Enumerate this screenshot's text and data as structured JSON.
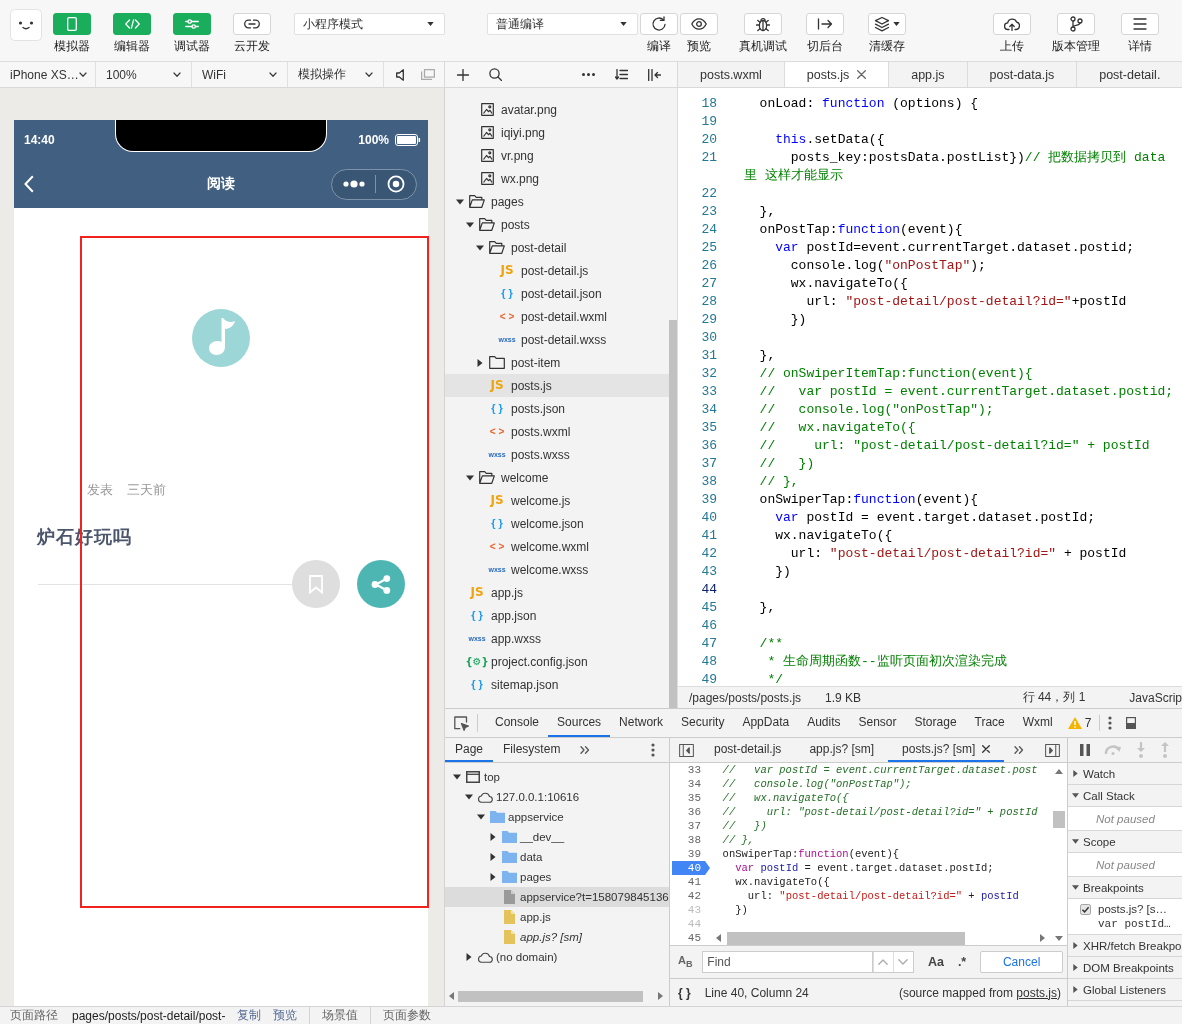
{
  "toolbar": {
    "view_toggles": [
      {
        "kind": "simulator",
        "label": "模拟器",
        "on": true
      },
      {
        "kind": "editor",
        "label": "编辑器",
        "on": true
      },
      {
        "kind": "debugger",
        "label": "调试器",
        "on": true
      },
      {
        "kind": "cloud",
        "label": "云开发",
        "on": false
      }
    ],
    "mode_select": {
      "value": "小程序模式"
    },
    "compile_select": {
      "value": "普通编译"
    },
    "compile_actions": [
      {
        "kind": "compile",
        "label": "编译"
      },
      {
        "kind": "preview",
        "label": "预览"
      }
    ],
    "debug_actions": [
      {
        "kind": "remote-debug",
        "label": "真机调试"
      },
      {
        "kind": "background",
        "label": "切后台"
      },
      {
        "kind": "cache",
        "label": "清缓存"
      }
    ],
    "project_actions": [
      {
        "kind": "upload",
        "label": "上传"
      },
      {
        "kind": "version",
        "label": "版本管理"
      },
      {
        "kind": "details",
        "label": "详情"
      }
    ]
  },
  "simulator_bar": {
    "selects": [
      {
        "value": "iPhone XS…"
      },
      {
        "value": "100%"
      },
      {
        "value": "WiFi"
      },
      {
        "value": "模拟操作"
      }
    ]
  },
  "editor_tabs": [
    {
      "label": "posts.wxml",
      "selected": false
    },
    {
      "label": "posts.js",
      "selected": true
    },
    {
      "label": "app.js",
      "selected": false
    },
    {
      "label": "post-data.js",
      "selected": false
    },
    {
      "label": "post-detail.",
      "selected": false
    }
  ],
  "simulator": {
    "status_bar": {
      "time": "14:40",
      "battery": "100%"
    },
    "nav_bar": {
      "title": "阅读"
    },
    "post": {
      "action": "发表",
      "date": "三天前",
      "title": "炉石好玩吗"
    }
  },
  "file_tree": [
    {
      "kind": "folder",
      "children": [
        {
          "name": "avatar.png",
          "kind": "image",
          "selected": false
        },
        {
          "name": "iqiyi.png",
          "kind": "image",
          "selected": false
        },
        {
          "name": "vr.png",
          "kind": "image",
          "selected": false
        },
        {
          "name": "wx.png",
          "kind": "image",
          "selected": false
        }
      ]
    },
    {
      "name": "pages",
      "kind": "folder",
      "expanded": true,
      "selected": false,
      "children": [
        {
          "name": "posts",
          "kind": "folder",
          "expanded": true,
          "selected": false,
          "children": [
            {
              "name": "post-detail",
              "kind": "folder",
              "expanded": true,
              "selected": false,
              "children": [
                {
                  "name": "post-detail.js",
                  "kind": "js",
                  "type_label": "JS",
                  "selected": false
                },
                {
                  "name": "post-detail.json",
                  "kind": "json",
                  "type_label": "{ }",
                  "selected": false
                },
                {
                  "name": "post-detail.wxml",
                  "kind": "wxml",
                  "type_label": "< >",
                  "selected": false
                },
                {
                  "name": "post-detail.wxss",
                  "kind": "wxss",
                  "type_label": "wxss",
                  "selected": false
                }
              ]
            },
            {
              "name": "post-item",
              "kind": "folder",
              "expanded": false,
              "selected": false
            },
            {
              "name": "posts.js",
              "kind": "js",
              "type_label": "JS",
              "selected": true
            },
            {
              "name": "posts.json",
              "kind": "json",
              "type_label": "{ }",
              "selected": false
            },
            {
              "name": "posts.wxml",
              "kind": "wxml",
              "type_label": "< >",
              "selected": false
            },
            {
              "name": "posts.wxss",
              "kind": "wxss",
              "type_label": "wxss",
              "selected": false
            }
          ]
        },
        {
          "name": "welcome",
          "kind": "folder",
          "expanded": true,
          "selected": false,
          "children": [
            {
              "name": "welcome.js",
              "kind": "js",
              "type_label": "JS",
              "selected": false
            },
            {
              "name": "welcome.json",
              "kind": "json",
              "type_label": "{ }",
              "selected": false
            },
            {
              "name": "welcome.wxml",
              "kind": "wxml",
              "type_label": "< >",
              "selected": false
            },
            {
              "name": "welcome.wxss",
              "kind": "wxss",
              "type_label": "wxss",
              "selected": false
            }
          ]
        }
      ]
    },
    {
      "name": "app.js",
      "kind": "js",
      "type_label": "JS",
      "selected": false
    },
    {
      "name": "app.json",
      "kind": "json",
      "type_label": "{ }",
      "selected": false
    },
    {
      "name": "app.wxss",
      "kind": "wxss",
      "type_label": "wxss",
      "selected": false
    },
    {
      "name": "project.config.json",
      "kind": "config",
      "type_label": "{⚙}",
      "selected": false
    },
    {
      "name": "sitemap.json",
      "kind": "json",
      "type_label": "{ }",
      "selected": false
    }
  ],
  "editor": {
    "lines": [
      {
        "number": "18",
        "current": false,
        "tokens": [
          {
            "kind": "plain",
            "text": "  onLoad: "
          },
          {
            "kind": "keyword",
            "text": "function"
          },
          {
            "kind": "plain",
            "text": " (options) {"
          }
        ]
      },
      {
        "number": "19",
        "current": false
      },
      {
        "number": "20",
        "current": false,
        "tokens": [
          {
            "kind": "keyword",
            "text": "    this"
          },
          {
            "kind": "plain",
            "text": ".setData({"
          }
        ]
      },
      {
        "number": "21",
        "current": false,
        "tokens": [
          {
            "kind": "plain",
            "text": "      posts_key:postsData.postList})"
          },
          {
            "kind": "comment",
            "text": "// 把数据拷贝到 data 里 这样才能显示"
          }
        ]
      },
      {
        "number": "22",
        "current": false
      },
      {
        "number": "23",
        "current": false,
        "tokens": [
          {
            "kind": "plain",
            "text": "  },"
          }
        ]
      },
      {
        "number": "24",
        "current": false,
        "tokens": [
          {
            "kind": "plain",
            "text": "  onPostTap:"
          },
          {
            "kind": "keyword",
            "text": "function"
          },
          {
            "kind": "plain",
            "text": "(event){"
          }
        ]
      },
      {
        "number": "25",
        "current": false,
        "tokens": [
          {
            "kind": "keyword",
            "text": "    var"
          },
          {
            "kind": "plain",
            "text": " postId=event.currentTarget.dataset.postid;"
          }
        ]
      },
      {
        "number": "26",
        "current": false,
        "tokens": [
          {
            "kind": "plain",
            "text": "      console.log("
          },
          {
            "kind": "string",
            "text": "\"onPostTap\""
          },
          {
            "kind": "plain",
            "text": ");"
          }
        ]
      },
      {
        "number": "27",
        "current": false,
        "tokens": [
          {
            "kind": "plain",
            "text": "      wx.navigateTo({"
          }
        ]
      },
      {
        "number": "28",
        "current": false,
        "tokens": [
          {
            "kind": "plain",
            "text": "        url: "
          },
          {
            "kind": "string",
            "text": "\"post-detail/post-detail?id=\""
          },
          {
            "kind": "plain",
            "text": "+postId"
          }
        ]
      },
      {
        "number": "29",
        "current": false,
        "tokens": [
          {
            "kind": "plain",
            "text": "      })"
          }
        ]
      },
      {
        "number": "30",
        "current": false
      },
      {
        "number": "31",
        "current": false,
        "tokens": [
          {
            "kind": "plain",
            "text": "  },"
          }
        ]
      },
      {
        "number": "32",
        "current": false,
        "tokens": [
          {
            "kind": "comment",
            "text": "  // onSwiperItemTap:function(event){"
          }
        ]
      },
      {
        "number": "33",
        "current": false,
        "tokens": [
          {
            "kind": "comment",
            "text": "  //   var postId = event.currentTarget.dataset.postid;"
          }
        ]
      },
      {
        "number": "34",
        "current": false,
        "tokens": [
          {
            "kind": "comment",
            "text": "  //   console.log(\"onPostTap\");"
          }
        ]
      },
      {
        "number": "35",
        "current": false,
        "tokens": [
          {
            "kind": "comment",
            "text": "  //   wx.navigateTo({"
          }
        ]
      },
      {
        "number": "36",
        "current": false,
        "tokens": [
          {
            "kind": "comment",
            "text": "  //     url: \"post-detail/post-detail?id=\" + postId"
          }
        ]
      },
      {
        "number": "37",
        "current": false,
        "tokens": [
          {
            "kind": "comment",
            "text": "  //   })"
          }
        ]
      },
      {
        "number": "38",
        "current": false,
        "tokens": [
          {
            "kind": "comment",
            "text": "  // },"
          }
        ]
      },
      {
        "number": "39",
        "current": false,
        "tokens": [
          {
            "kind": "plain",
            "text": "  onSwiperTap:"
          },
          {
            "kind": "keyword",
            "text": "function"
          },
          {
            "kind": "plain",
            "text": "(event){"
          }
        ]
      },
      {
        "number": "40",
        "current": false,
        "tokens": [
          {
            "kind": "keyword",
            "text": "    var"
          },
          {
            "kind": "plain",
            "text": " postId = event.target.dataset.postId;"
          }
        ]
      },
      {
        "number": "41",
        "current": false,
        "tokens": [
          {
            "kind": "plain",
            "text": "    wx.navigateTo({"
          }
        ]
      },
      {
        "number": "42",
        "current": false,
        "tokens": [
          {
            "kind": "plain",
            "text": "      url: "
          },
          {
            "kind": "string",
            "text": "\"post-detail/post-detail?id=\""
          },
          {
            "kind": "plain",
            "text": " + postId"
          }
        ]
      },
      {
        "number": "43",
        "current": false,
        "tokens": [
          {
            "kind": "plain",
            "text": "    })"
          }
        ]
      },
      {
        "number": "44",
        "current": true
      },
      {
        "number": "45",
        "current": false,
        "tokens": [
          {
            "kind": "plain",
            "text": "  },"
          }
        ]
      },
      {
        "number": "46",
        "current": false
      },
      {
        "number": "47",
        "current": false,
        "tokens": [
          {
            "kind": "comment",
            "text": "  /**"
          }
        ]
      },
      {
        "number": "48",
        "current": false,
        "tokens": [
          {
            "kind": "comment",
            "text": "   * 生命周期函数--监听页面初次渲染完成"
          }
        ]
      },
      {
        "number": "49",
        "current": false,
        "tokens": [
          {
            "kind": "comment",
            "text": "   */"
          }
        ]
      }
    ],
    "status": {
      "path": "/pages/posts/posts.js",
      "size": "1.9 KB",
      "cursor": "行 44，列 1",
      "language": "JavaScrip"
    }
  },
  "devtools": {
    "tabs": [
      {
        "label": "Console",
        "selected": false
      },
      {
        "label": "Sources",
        "selected": true
      },
      {
        "label": "Network",
        "selected": false
      },
      {
        "label": "Security",
        "selected": false
      },
      {
        "label": "AppData",
        "selected": false
      },
      {
        "label": "Audits",
        "selected": false
      },
      {
        "label": "Sensor",
        "selected": false
      },
      {
        "label": "Storage",
        "selected": false
      },
      {
        "label": "Trace",
        "selected": false
      },
      {
        "label": "Wxml",
        "selected": false
      }
    ],
    "warning_count": "7",
    "navigator_tabs": [
      {
        "label": "Page",
        "selected": true
      },
      {
        "label": "Filesystem",
        "selected": false
      }
    ],
    "page_tree": [
      {
        "name": "top",
        "kind": "frame",
        "expanded": true,
        "selected": false,
        "children": [
          {
            "name": "127.0.0.1:10616",
            "kind": "domain",
            "expanded": true,
            "selected": false,
            "children": [
              {
                "name": "appservice",
                "kind": "folder",
                "expanded": true,
                "selected": false,
                "children": [
                  {
                    "name": "__dev__",
                    "kind": "folder",
                    "expanded": false,
                    "selected": false
                  },
                  {
                    "name": "data",
                    "kind": "folder",
                    "expanded": false,
                    "selected": false
                  },
                  {
                    "name": "pages",
                    "kind": "folder",
                    "expanded": false,
                    "selected": false
                  },
                  {
                    "name": "appservice?t=158079845136",
                    "kind": "document",
                    "selected": true
                  },
                  {
                    "name": "app.js",
                    "kind": "script",
                    "selected": false
                  },
                  {
                    "name": "app.js? [sm]",
                    "kind": "mapped",
                    "selected": false
                  }
                ]
              }
            ]
          },
          {
            "name": "(no domain)",
            "kind": "domain",
            "expanded": false,
            "selected": false
          }
        ]
      }
    ],
    "source_tabs": [
      {
        "label": "post-detail.js",
        "selected": false
      },
      {
        "label": "app.js? [sm]",
        "selected": false
      },
      {
        "label": "posts.js? [sm]",
        "selected": true
      }
    ],
    "source_lines": [
      {
        "number": "33",
        "breakpoint": false,
        "dimmed": false,
        "tokens": [
          {
            "kind": "comment",
            "text": "  //   var postId = event.currentTarget.dataset.post"
          }
        ]
      },
      {
        "number": "34",
        "breakpoint": false,
        "dimmed": false,
        "tokens": [
          {
            "kind": "comment",
            "text": "  //   console.log(\"onPostTap\");"
          }
        ]
      },
      {
        "number": "35",
        "breakpoint": false,
        "dimmed": false,
        "tokens": [
          {
            "kind": "comment",
            "text": "  //   wx.navigateTo({"
          }
        ]
      },
      {
        "number": "36",
        "breakpoint": false,
        "dimmed": false,
        "tokens": [
          {
            "kind": "comment",
            "text": "  //     url: \"post-detail/post-detail?id=\" + postId"
          }
        ]
      },
      {
        "number": "37",
        "breakpoint": false,
        "dimmed": false,
        "tokens": [
          {
            "kind": "comment",
            "text": "  //   })"
          }
        ]
      },
      {
        "number": "38",
        "breakpoint": false,
        "dimmed": false,
        "tokens": [
          {
            "kind": "comment",
            "text": "  // },"
          }
        ]
      },
      {
        "number": "39",
        "breakpoint": false,
        "dimmed": false,
        "tokens": [
          {
            "kind": "plain",
            "text": "  onSwiperTap:"
          },
          {
            "kind": "keyword",
            "text": "function"
          },
          {
            "kind": "plain",
            "text": "(event){"
          }
        ]
      },
      {
        "number": "40",
        "breakpoint": true,
        "dimmed": false,
        "tokens": [
          {
            "kind": "keyword",
            "text": "    var "
          },
          {
            "kind": "name",
            "text": "postId"
          },
          {
            "kind": "plain",
            "text": " = event.target.dataset.postId;"
          }
        ]
      },
      {
        "number": "41",
        "breakpoint": false,
        "dimmed": false,
        "tokens": [
          {
            "kind": "plain",
            "text": "    wx.navigateTo({"
          }
        ]
      },
      {
        "number": "42",
        "breakpoint": false,
        "dimmed": false,
        "tokens": [
          {
            "kind": "plain",
            "text": "      url: "
          },
          {
            "kind": "string",
            "text": "\"post-detail/post-detail?id=\""
          },
          {
            "kind": "plain",
            "text": " + "
          },
          {
            "kind": "name",
            "text": "postId"
          }
        ]
      },
      {
        "number": "43",
        "breakpoint": false,
        "dimmed": true,
        "tokens": [
          {
            "kind": "plain",
            "text": "    })"
          }
        ]
      },
      {
        "number": "44",
        "breakpoint": false,
        "dimmed": true
      },
      {
        "number": "45",
        "breakpoint": false,
        "dimmed": false
      }
    ],
    "find": {
      "replace_toggle": "A$_{B}$",
      "placeholder": "Find",
      "case_toggle": "Aa",
      "regex_toggle": ".*",
      "cancel": "Cancel"
    },
    "status": {
      "format_button": "{ }",
      "position": "Line 40, Column 24",
      "source_prefix": "(source mapped from ",
      "source_link": "posts.js",
      "source_suffix": ")"
    },
    "debugger_controls": [
      {
        "kind": "pause",
        "disabled": false
      },
      {
        "kind": "step-over",
        "disabled": true
      },
      {
        "kind": "step-into",
        "disabled": true
      },
      {
        "kind": "step-out",
        "disabled": true
      }
    ],
    "debugger_sections": [
      {
        "title": "Watch",
        "expanded": false
      },
      {
        "title": "Call Stack",
        "expanded": true,
        "message": "Not paused"
      },
      {
        "title": "Scope",
        "expanded": true,
        "message": "Not paused"
      },
      {
        "title": "Breakpoints",
        "expanded": true,
        "breakpoints": [
          {
            "file": "posts.js? [s…",
            "code": "var postId…",
            "checked": true
          }
        ]
      },
      {
        "title": "XHR/fetch Breakpo",
        "expanded": false
      },
      {
        "title": "DOM Breakpoints",
        "expanded": false
      },
      {
        "title": "Global Listeners",
        "expanded": false
      }
    ]
  },
  "page_status": {
    "label": "页面路径",
    "path": "pages/posts/post-detail/post-",
    "links": [
      "复制",
      "预览"
    ],
    "scene": "场景值",
    "params": "页面参数"
  }
}
